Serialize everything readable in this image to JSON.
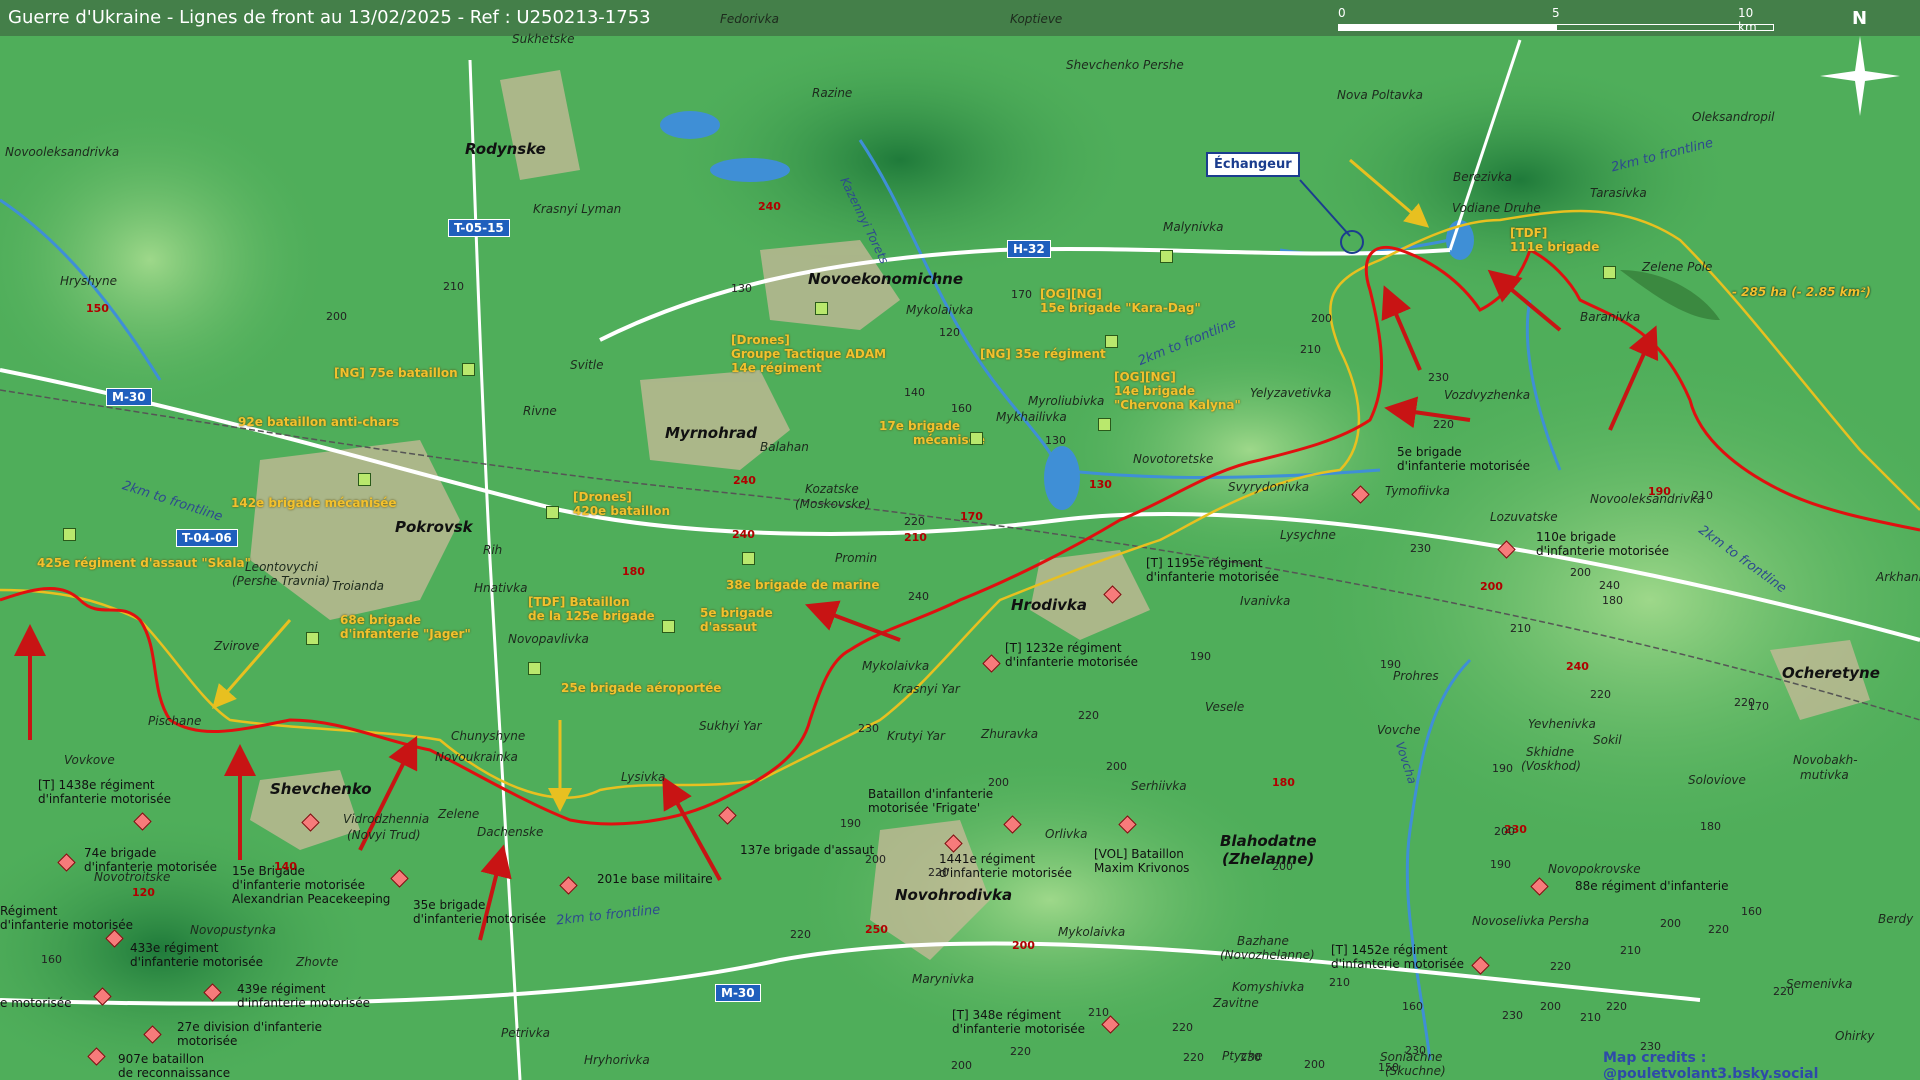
{
  "header": {
    "title": "Guerre d'Ukraine - Lignes de front au 13/02/2025 - Ref : U250213-1753",
    "scale_labels": [
      "0",
      "5",
      "10 km"
    ],
    "north_label": "N"
  },
  "colors": {
    "terrain": "#4fae5a",
    "frontline": "#e01010",
    "ukr_line": "#e8c020",
    "road_badge": "#1f5fbd",
    "river": "#3f8fd6"
  },
  "interchange_label": "Échangeur",
  "area_annotation": "- 285 ha (- 2.85 km²)",
  "credits": "Map credits : @pouletvolant3.bsky.social",
  "cities": {
    "rodynske": "Rodynske",
    "novoekonomichne": "Novoekonomichne",
    "myrnohrad": "Myrnohrad",
    "pokrovsk": "Pokrovsk",
    "hrodivka": "Hrodivka",
    "shevchenko": "Shevchenko",
    "novohrodivka": "Novohrodivka",
    "blahodatne": "Blahodatne",
    "blahodatne_alt": "(Zhelanne)",
    "ocheretyne": "Ocheretyne"
  },
  "towns": {
    "fedorivka": "Fedorivka",
    "koptieve": "Koptieve",
    "sukhetske": "Sukhetske",
    "razine": "Razine",
    "shevchenko_pershe": "Shevchenko Pershe",
    "nova_poltavka": "Nova Poltavka",
    "oleksandropil": "Oleksandropil",
    "novooleksandrivka": "Novooleksandrivka",
    "krasnyi_lyman": "Krasnyi Lyman",
    "malynivka": "Malynivka",
    "berezivka": "Berezivka",
    "vodiane_druhe": "Vodiane Druhe",
    "tarasivka": "Tarasivka",
    "zelene_pole": "Zelene Pole",
    "hryshyne": "Hryshyne",
    "baranivka": "Baranivka",
    "mykolaivka1": "Mykolaivka",
    "svitle": "Svitle",
    "rivne": "Rivne",
    "myroliubivka": "Myroliubivka",
    "mykhailivka": "Mykhailivka",
    "yelyzavetivka": "Yelyzavetivka",
    "vozdvyzhenka": "Vozdvyzhenka",
    "balahan": "Balahan",
    "novotoretske": "Novotoretske",
    "svyrydonivka": "Svyrydonivka",
    "tymofiivka": "Tymofiivka",
    "kozatske": "Kozatske",
    "kozatske_alt": "(Moskovske)",
    "lozuvatske": "Lozuvatske",
    "novooleksandrivka2": "Novooleksandrivka",
    "lysychne": "Lysychne",
    "rih": "Rih",
    "promin": "Promin",
    "leontovychi": "Leontovychi",
    "leontovychi_alt": "(Pershe Travnia)",
    "troianda": "Troianda",
    "hnativka": "Hnativka",
    "ivanivka": "Ivanivka",
    "arkhanh": "Arkhanh",
    "zvirove": "Zvirove",
    "novopavlivka": "Novopavlivka",
    "mykolaivka2": "Mykolaivka",
    "krasnyi_yar": "Krasnyi Yar",
    "pischane": "Pischane",
    "chunyshyne": "Chunyshyne",
    "sukhyi_yar": "Sukhyi Yar",
    "krutyi_yar": "Krutyi Yar",
    "zhuravka": "Zhuravka",
    "vesele": "Vesele",
    "prohres": "Prohres",
    "vovchie": "Vovche",
    "yevhenivka": "Yevhenivka",
    "sokil": "Sokil",
    "skhidne": "Skhidne",
    "skhidne_alt": "(Voskhod)",
    "soloviove": "Soloviove",
    "novobakhmutivka": "Novobakh-",
    "novobakhmutivka2": "mutivka",
    "vovkove": "Vovkove",
    "novoukrainka": "Novoukrainka",
    "lysivka": "Lysivka",
    "serhiivka": "Serhiivka",
    "vidrodzhennia": "Vidrodzhennia",
    "vidrodzhennia_alt": "(Novyi Trud)",
    "zelene": "Zelene",
    "dachenske": "Dachenske",
    "orlivka": "Orlivka",
    "novopokrovske": "Novopokrovske",
    "novoselivka_persha": "Novoselivka Persha",
    "novotroitske": "Novotroitske",
    "novopustynka": "Novopustynka",
    "zhovte": "Zhovte",
    "mykolaivka3": "Mykolaivka",
    "bazhane": "Bazhane",
    "bazhane_alt": "(Novozhelanne)",
    "berdy": "Berdy",
    "marynivka": "Marynivka",
    "komyshivka": "Komyshivka",
    "semenivka": "Semenivka",
    "zavitne": "Zavitne",
    "petrivka": "Petrivka",
    "hryhorivka": "Hryhorivka",
    "ptyche": "Ptyche",
    "soniachne": "Soniachne",
    "soniachne_alt": "(Skuchne)",
    "ohirky": "Ohirky",
    "kazennyi_torets": "Kazennyi Torets",
    "vovcha": "Vovcha"
  },
  "roads": {
    "t0515": "T-05-15",
    "h32": "H-32",
    "m30a": "M-30",
    "t0406": "T-04-06",
    "m30b": "M-30"
  },
  "elevations": [
    "240",
    "210",
    "150",
    "200",
    "130",
    "120",
    "140",
    "170",
    "160",
    "130",
    "130",
    "240",
    "210",
    "240",
    "240",
    "170",
    "220",
    "200",
    "210",
    "230",
    "220",
    "210",
    "200",
    "190",
    "180",
    "210",
    "200",
    "230",
    "240",
    "190",
    "220",
    "220",
    "240",
    "180",
    "230",
    "140",
    "120",
    "160",
    "250",
    "220",
    "200",
    "210",
    "220",
    "230",
    "180",
    "230",
    "190",
    "160",
    "150",
    "200",
    "210",
    "230",
    "170",
    "160",
    "220",
    "220",
    "200",
    "180",
    "210",
    "190",
    "200",
    "220",
    "220",
    "230",
    "200",
    "200",
    "190",
    "220",
    "200",
    "200",
    "190",
    "200",
    "220",
    "200",
    "220",
    "220",
    "210",
    "230"
  ],
  "frontline_labels": [
    "2km to frontline",
    "2km to frontline",
    "2km to frontline",
    "2km to frontline",
    "2km to frontline"
  ],
  "ukr_units": {
    "u1": "[NG] 75e bataillon",
    "u2": "92e bataillon anti-chars",
    "u3a": "[Drones]",
    "u3b": "Groupe Tactique ADAM",
    "u3c": "14e régiment",
    "u4a": "[OG][NG]",
    "u4b": "15e brigade \"Kara-Dag\"",
    "u5": "[NG] 35e régiment",
    "u6a": "[OG][NG]",
    "u6b": "14e brigade",
    "u6c": "\"Chervona Kalyna\"",
    "u7a": "17e brigade",
    "u7b": "mécanisée",
    "u8": "142e brigade mécanisée",
    "u9a": "[Drones]",
    "u9b": "420e bataillon",
    "u10": "425e régiment d'assaut \"Skala\"",
    "u11a": "[TDF]",
    "u11b": "111e brigade",
    "u12": "38e brigade de marine",
    "u13a": "[TDF] Bataillon",
    "u13b": "de la 125e brigade",
    "u14a": "5e brigade",
    "u14b": "d'assaut",
    "u15a": "68e brigade",
    "u15b": "d'infanterie \"Jager\"",
    "u16": "25e brigade aéroportée"
  },
  "ru_units": {
    "r1a": "5e brigade",
    "r1b": "d'infanterie motorisée",
    "r2a": "110e brigade",
    "r2b": "d'infanterie motorisée",
    "r3a": "[T] 1195e régiment",
    "r3b": "d'infanterie motorisée",
    "r4a": "[T] 1232e régiment",
    "r4b": "d'infanterie motorisée",
    "r5a": "[T] 1438e régiment",
    "r5b": "d'infanterie motorisée",
    "r6a": "74e brigade",
    "r6b": "d'infanterie motorisée",
    "r7a": "15e Brigade",
    "r7b": "d'infanterie motorisée",
    "r7c": "Alexandrian Peacekeeping",
    "r8a": "35e brigade",
    "r8b": "d'infanterie motorisée",
    "r9": "201e base militaire",
    "r10": "137e brigade d'assaut",
    "r11a": "Bataillon d'infanterie",
    "r11b": "motorisée 'Frigate'",
    "r12a": "1441e régiment",
    "r12b": "d'infanterie motorisée",
    "r13a": "[VOL] Bataillon",
    "r13b": "Maxim Krivonos",
    "r14": "88e régiment d'infanterie",
    "r15a": "[T] 1452e régiment",
    "r15b": "d'infanterie motorisée",
    "r16a": "[T] 348e régiment",
    "r16b": "d'infanterie motorisée",
    "r17a": "433e régiment",
    "r17b": "d'infanterie motorisée",
    "r18a": "439e régiment",
    "r18b": "d'infanterie motorisée",
    "r19a": "27e division d'infanterie",
    "r19b": "motorisée",
    "r20a": "907e bataillon",
    "r20b": "de reconnaissance",
    "r21a": "Régiment",
    "r21b": "d'infanterie motorisée",
    "r22": "e motorisée"
  }
}
